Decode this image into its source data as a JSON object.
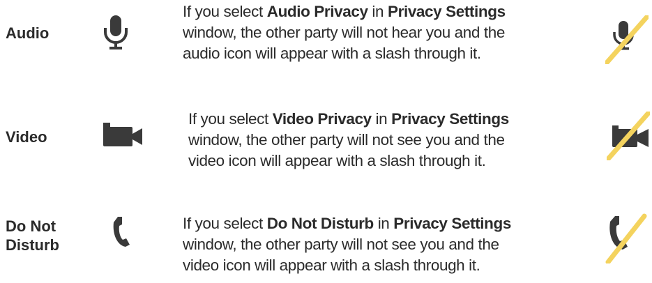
{
  "rows": [
    {
      "label": "Audio",
      "icon": "microphone-icon",
      "text": {
        "p1": "If you select ",
        "b1": "Audio Privacy",
        "p2": " in ",
        "b2": "Privacy Settings",
        "line2": "window, the other party will not hear you and the",
        "line3": "audio icon will appear with a slash through it."
      }
    },
    {
      "label": "Video",
      "icon": "video-camera-icon",
      "text": {
        "p1": "If you select ",
        "b1": "Video Privacy",
        "p2": " in ",
        "b2": "Privacy Settings",
        "line2": "window, the other party will not see you and the",
        "line3": "video icon will appear with a slash through it."
      }
    },
    {
      "label_line1": "Do Not",
      "label_line2": "Disturb",
      "icon": "phone-handset-icon",
      "text": {
        "p1": "If you select ",
        "b1": "Do Not Disturb",
        "p2": " in ",
        "b2": "Privacy Settings",
        "line2": "window, the other party will not see you and the",
        "line3": "video icon will appear with a slash through it."
      }
    }
  ],
  "colors": {
    "text": "#2b2b2b",
    "icon": "#3a3a3a",
    "slash": "#f4d35e"
  }
}
